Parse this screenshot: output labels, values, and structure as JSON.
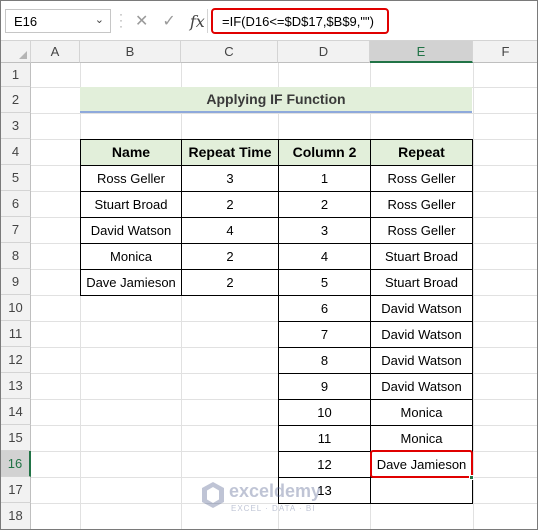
{
  "formula_bar": {
    "name_box": "E16",
    "name_box_arrow": "⌄",
    "cancel_icon": "✕",
    "enter_icon": "✓",
    "fx_label": "fx",
    "formula": "=IF(D16<=$D$17,$B$9,\"\")"
  },
  "columns": [
    "A",
    "B",
    "C",
    "D",
    "E",
    "F"
  ],
  "rows": [
    "1",
    "2",
    "3",
    "4",
    "5",
    "6",
    "7",
    "8",
    "9",
    "10",
    "11",
    "12",
    "13",
    "14",
    "15",
    "16",
    "17",
    "18"
  ],
  "selected": {
    "column": "E",
    "row": "16"
  },
  "title": "Applying IF Function",
  "table1": {
    "headers": [
      "Name",
      "Repeat Time"
    ],
    "rows": [
      [
        "Ross Geller",
        "3"
      ],
      [
        "Stuart Broad",
        "2"
      ],
      [
        "David Watson",
        "4"
      ],
      [
        "Monica",
        "2"
      ],
      [
        "Dave Jamieson",
        "2"
      ]
    ]
  },
  "table2": {
    "headers": [
      "Column 2",
      "Repeat"
    ],
    "rows": [
      [
        "1",
        "Ross Geller"
      ],
      [
        "2",
        "Ross Geller"
      ],
      [
        "3",
        "Ross Geller"
      ],
      [
        "4",
        "Stuart Broad"
      ],
      [
        "5",
        "Stuart Broad"
      ],
      [
        "6",
        "David Watson"
      ],
      [
        "7",
        "David Watson"
      ],
      [
        "8",
        "David Watson"
      ],
      [
        "9",
        "David Watson"
      ],
      [
        "10",
        "Monica"
      ],
      [
        "11",
        "Monica"
      ],
      [
        "12",
        "Dave Jamieson"
      ],
      [
        "13",
        ""
      ]
    ]
  },
  "watermark": {
    "name": "exceldemy",
    "tagline": "EXCEL · DATA · BI"
  },
  "colors": {
    "accent_red": "#e00000",
    "header_fill": "#e2efda",
    "excel_green": "#217346"
  }
}
